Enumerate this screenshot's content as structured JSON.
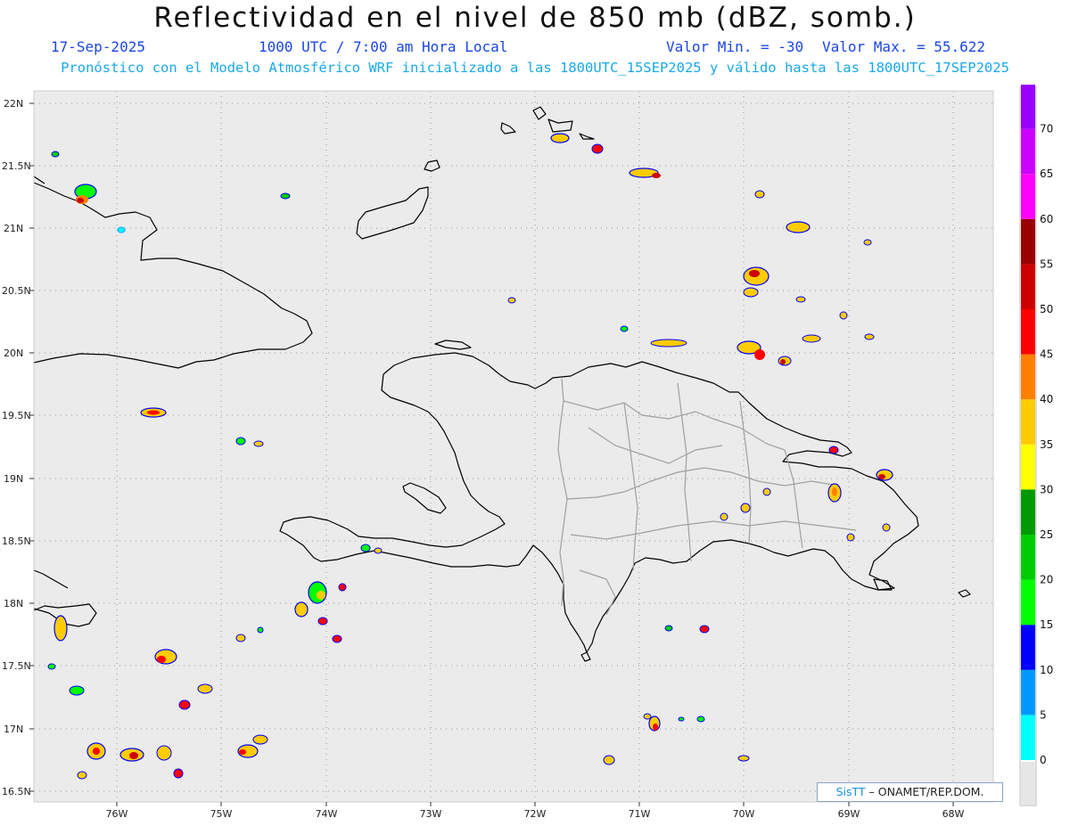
{
  "header": {
    "title": "Reflectividad en el nivel de 850 mb (dBZ, somb.)",
    "date": "17-Sep-2025",
    "time": "1000 UTC / 7:00 am Hora Local",
    "min_label": "Valor Min. = -30",
    "max_label": "Valor Max. = 55.622",
    "forecast_note": "Pronóstico con el Modelo Atmosférico WRF inicializado a las 1800UTC_15SEP2025 y válido hasta las  1800UTC_17SEP2025"
  },
  "map": {
    "lat_labels": [
      "22N",
      "21.5N",
      "21N",
      "20.5N",
      "20N",
      "19.5N",
      "19N",
      "18.5N",
      "18N",
      "17.5N",
      "17N",
      "16.5N"
    ],
    "lon_labels": [
      "76W",
      "75W",
      "74W",
      "73W",
      "72W",
      "71W",
      "70W",
      "69W",
      "68W"
    ],
    "background_color": "#ebebeb",
    "coast_color": "#000000",
    "border_color": "#a0a0a0"
  },
  "colorbar": {
    "levels": [
      "0",
      "5",
      "10",
      "15",
      "20",
      "25",
      "30",
      "35",
      "40",
      "45",
      "50",
      "55",
      "60",
      "65",
      "70"
    ],
    "colors": [
      "#00ffff",
      "#0099ff",
      "#0000ff",
      "#00ff00",
      "#00cc00",
      "#009900",
      "#ffff00",
      "#ffcc00",
      "#ff8000",
      "#ff0000",
      "#cc0000",
      "#990000",
      "#ff00ff",
      "#cc00ff",
      "#9900ff"
    ]
  },
  "credit": {
    "brand": "SisTT",
    "org": "– ONAMET/REP.DOM."
  }
}
